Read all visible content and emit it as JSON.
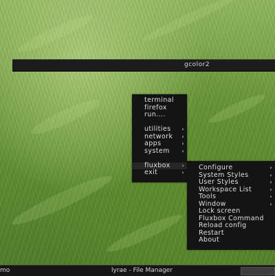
{
  "window": {
    "title": "gcolor2"
  },
  "root_menu": {
    "items": [
      {
        "label": "terminal",
        "submenu": false
      },
      {
        "label": "firefox",
        "submenu": false
      },
      {
        "label": "run....",
        "submenu": false
      },
      {
        "label": "utilities",
        "submenu": true
      },
      {
        "label": "network",
        "submenu": true
      },
      {
        "label": "apps",
        "submenu": true
      },
      {
        "label": "system",
        "submenu": true
      },
      {
        "label": "fluxbox",
        "submenu": true
      },
      {
        "label": "exit",
        "submenu": true
      }
    ],
    "arrow_glyph": "›"
  },
  "fluxbox_menu": {
    "items": [
      {
        "label": "Configure",
        "submenu": true
      },
      {
        "label": "System Styles",
        "submenu": true
      },
      {
        "label": "User Styles",
        "submenu": true
      },
      {
        "label": "Workspace List",
        "submenu": true
      },
      {
        "label": "Tools",
        "submenu": true
      },
      {
        "label": "Window",
        "submenu": true
      },
      {
        "label": "Lock screen",
        "submenu": false
      },
      {
        "label": "Fluxbox Command",
        "submenu": false
      },
      {
        "label": "Reload config",
        "submenu": false
      },
      {
        "label": "Restart",
        "submenu": false
      },
      {
        "label": "About",
        "submenu": false
      }
    ],
    "arrow_glyph": "›"
  },
  "taskbar": {
    "left_label": "mo",
    "task_title": "lyrae - File Manager"
  },
  "colors": {
    "menu_bg": "#141414",
    "menu_text": "#e0e0e0",
    "bar_bg": "#1c1c1c",
    "wallpaper_green": "#6f9a3f"
  }
}
